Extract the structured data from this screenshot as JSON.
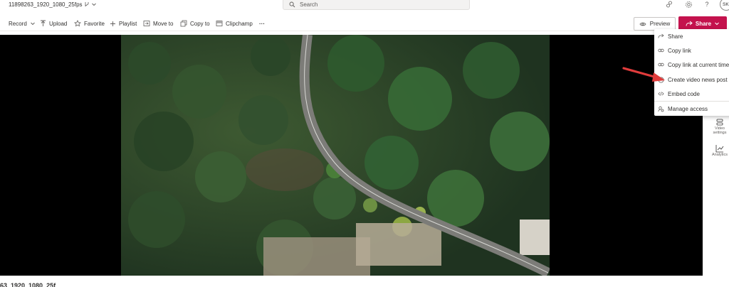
{
  "header": {
    "file_name": "11898263_1920_1080_25fps",
    "search_placeholder": "Search",
    "avatar_initials": "SK"
  },
  "toolbar": {
    "record": "Record",
    "upload": "Upload",
    "favorite": "Favorite",
    "playlist": "Playlist",
    "move_to": "Move to",
    "copy_to": "Copy to",
    "clipchamp": "Clipchamp",
    "more": "···",
    "preview": "Preview",
    "share": "Share"
  },
  "share_menu": {
    "items": [
      {
        "label": "Share",
        "icon": "share-icon"
      },
      {
        "label": "Copy link",
        "icon": "link-icon"
      },
      {
        "label": "Copy link at current time",
        "icon": "link-time-icon"
      },
      {
        "label": "Create video news post",
        "icon": "news-icon"
      },
      {
        "label": "Embed code",
        "icon": "code-icon"
      },
      {
        "label": "Manage access",
        "icon": "manage-access-icon"
      }
    ]
  },
  "right_rail": {
    "video_settings": "Video settings",
    "analytics": "Analytics"
  },
  "footer": {
    "title_partial": "63_1920_1080_25f"
  },
  "colors": {
    "accent": "#c4124d",
    "annotation_arrow": "#e03c3c"
  }
}
